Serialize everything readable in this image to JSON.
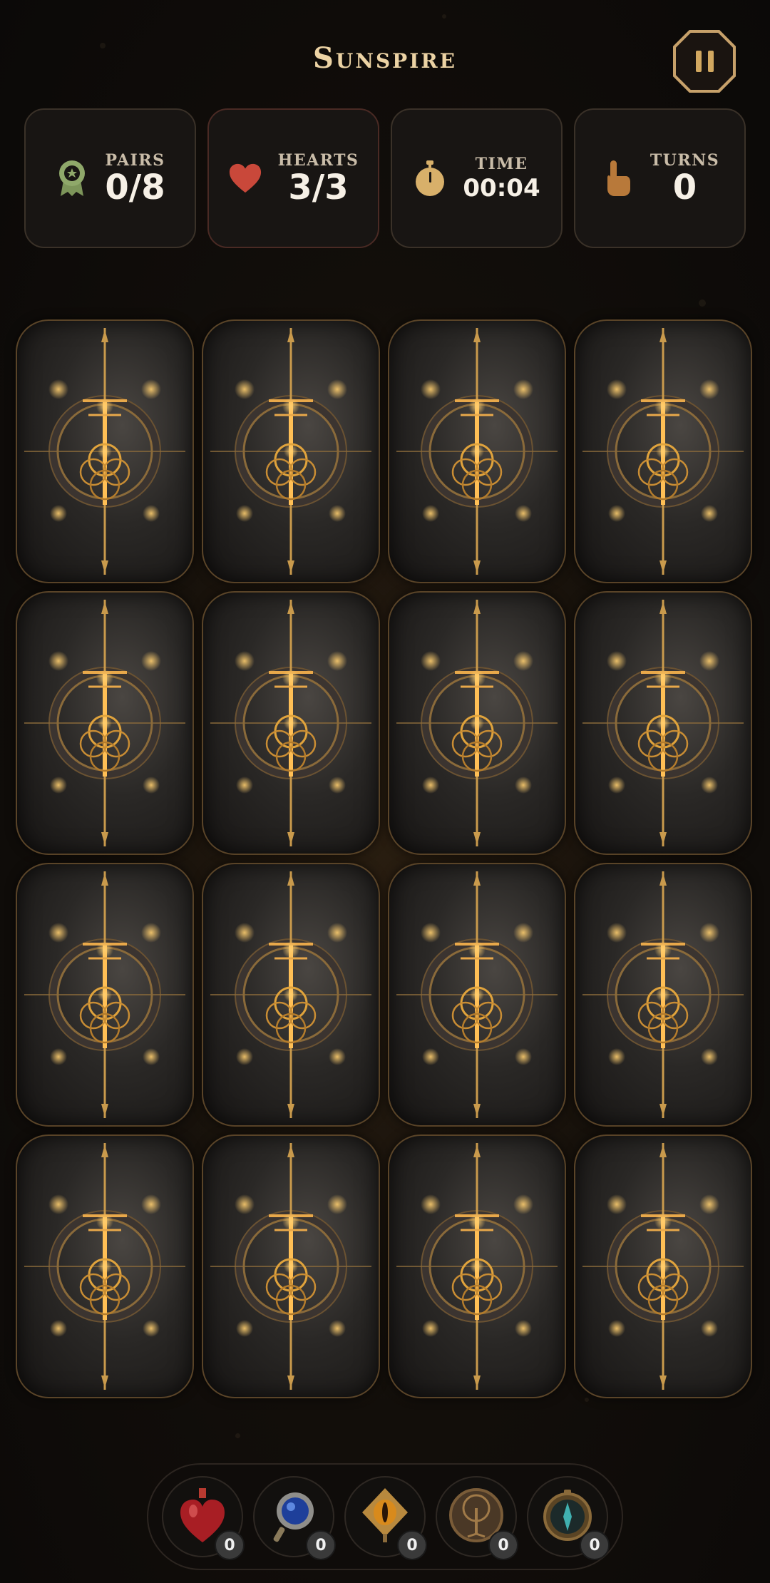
{
  "game": {
    "title": "Sunspire"
  },
  "header": {
    "pause_icon": "pause-icon"
  },
  "stats": {
    "pairs": {
      "label": "PAIRS",
      "value": "0/8",
      "icon": "ribbon-badge-icon",
      "color": "#8fa86a"
    },
    "hearts": {
      "label": "HEARTS",
      "value": "3/3",
      "icon": "heart-icon",
      "color": "#c9483a"
    },
    "time": {
      "label": "TIME",
      "value": "00:04",
      "icon": "stopwatch-icon",
      "color": "#d8b06a"
    },
    "turns": {
      "label": "TURNS",
      "value": "0",
      "icon": "pointing-hand-icon",
      "color": "#b8793a"
    }
  },
  "board": {
    "rows": 4,
    "columns": 4,
    "cards_face_down": 16,
    "card_back": "golden-rune-sigil",
    "accent": "#e0a33c"
  },
  "inventory": {
    "items": [
      {
        "name": "heart-potion-icon",
        "count": "0"
      },
      {
        "name": "blue-orb-amulet-icon",
        "count": "0"
      },
      {
        "name": "eye-sigil-icon",
        "count": "0"
      },
      {
        "name": "tree-medallion-icon",
        "count": "0"
      },
      {
        "name": "compass-icon",
        "count": "0"
      }
    ]
  }
}
